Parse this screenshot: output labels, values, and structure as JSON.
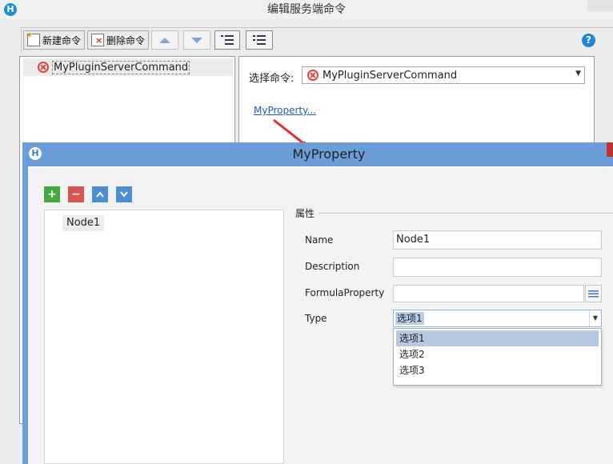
{
  "window": {
    "title": "编辑服务端命令",
    "logo_glyph": "H"
  },
  "toolbar": {
    "new_label": "新建命令",
    "delete_label": "删除命令"
  },
  "command_list": {
    "items": [
      {
        "label": "MyPluginServerCommand"
      }
    ]
  },
  "command_panel": {
    "select_label": "选择命令:",
    "selected": "MyPluginServerCommand",
    "property_link": "MyProperty..."
  },
  "help_glyph": "?",
  "dialog": {
    "title": "MyProperty",
    "buttons": {
      "add": "+",
      "remove": "−"
    },
    "tree": {
      "nodes": [
        {
          "label": "Node1"
        }
      ]
    },
    "props": {
      "section": "属性",
      "name_label": "Name",
      "name_value": "Node1",
      "description_label": "Description",
      "description_value": "",
      "formula_label": "FormulaProperty",
      "formula_value": "",
      "type_label": "Type",
      "type_value": "选项1",
      "type_options": [
        "选项1",
        "选项2",
        "选项3"
      ]
    }
  },
  "colors": {
    "accent": "#6b9ed8",
    "error": "#e0423c",
    "link": "#1e5fb4",
    "arrow": "#e0302a"
  }
}
